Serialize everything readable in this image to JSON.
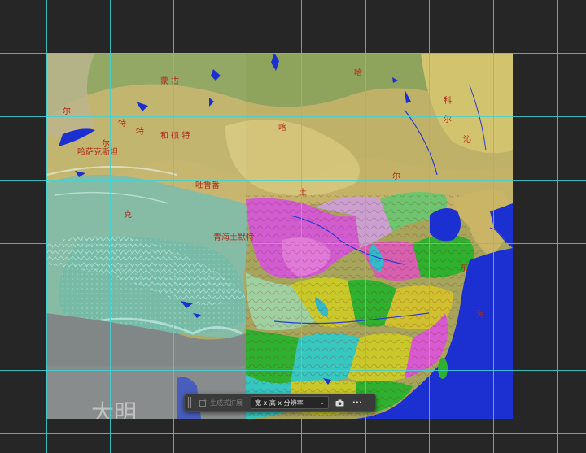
{
  "canvas": {
    "map_labels": {
      "top_1": "哈",
      "top_2": "喀",
      "top_left_1": "尔",
      "top_left_2": "特",
      "mongolia": "蒙 古",
      "kazakh_1": "尔",
      "kazakh_2": "特",
      "kazakh_3": "哈萨克斯坦",
      "kazakh_4": "和 硕 特",
      "tuluf": "吐鲁番",
      "ke": "克",
      "qinghai": "青海土默特",
      "right_1": "科",
      "right_2": "尔",
      "right_3": "沁",
      "mid_1": "尔",
      "mid_2": "土",
      "sea_dong": "东",
      "sea_hai": "海",
      "bottom_big": "大明"
    },
    "colors": {
      "background": "#262626",
      "guides": "#3fd3d3",
      "sea": "#1c2fd0",
      "desert": "#c8b46a",
      "steppe": "#8ea35c",
      "plateau": "#6fb7a2",
      "ming_magenta": "#d05ccf",
      "ming_green": "#2fb02f",
      "ming_yellow": "#c8c82a",
      "ming_cyan": "#35c7c0"
    }
  },
  "contextual_taskbar": {
    "generative_expand_label": "生成式扩展",
    "generative_icon": "generative-expand-icon",
    "size_select_value": "宽 x 高 x 分辨率",
    "size_select_icon": "chevron-down-icon",
    "camera_icon": "camera-icon",
    "more_icon": "more-icon",
    "more_glyph": "•••"
  }
}
